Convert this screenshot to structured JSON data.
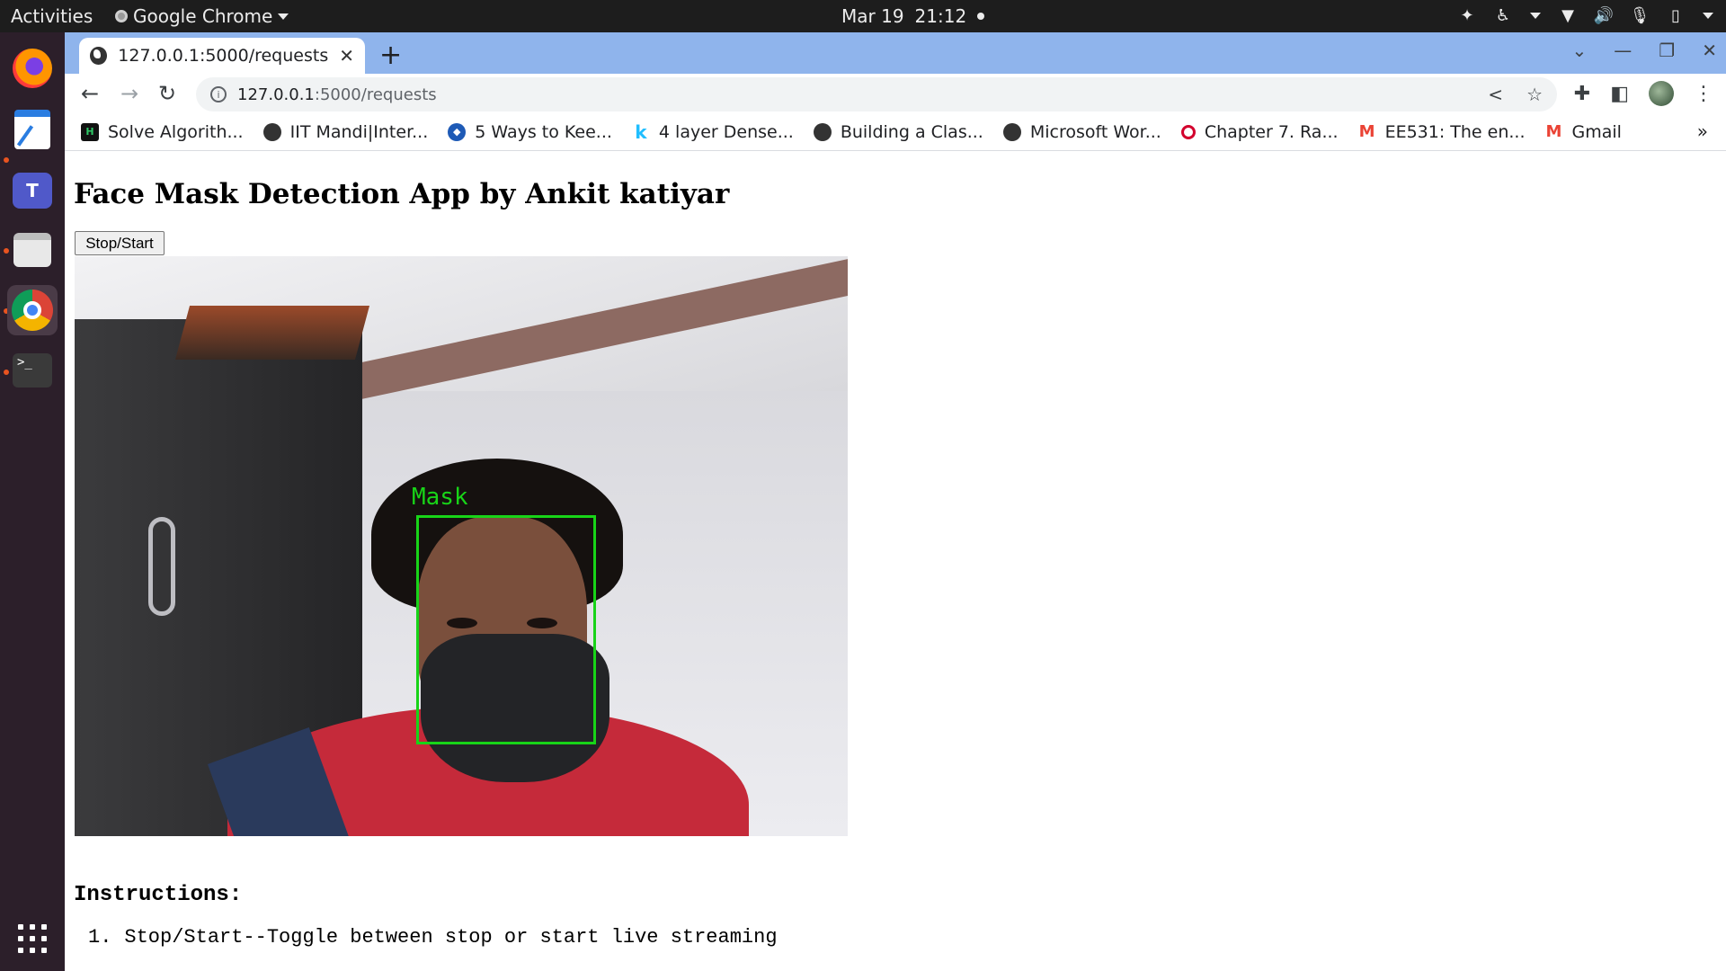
{
  "topbar": {
    "activities": "Activities",
    "app_name": "Google Chrome",
    "date": "Mar 19",
    "time": "21:12"
  },
  "dock": {
    "items": [
      "firefox",
      "text-editor",
      "teams",
      "files",
      "chrome",
      "terminal"
    ],
    "accent": "#e95420"
  },
  "browser": {
    "tab_title": "127.0.0.1:5000/requests",
    "url_host": "127.0.0.1",
    "url_path": ":5000/requests",
    "bookmarks": [
      {
        "label": "Solve Algorith...",
        "icon": "hackerrank-icon"
      },
      {
        "label": "IIT Mandi|Inter...",
        "icon": "globe-icon"
      },
      {
        "label": "5 Ways to Kee...",
        "icon": "shield-icon"
      },
      {
        "label": "4 layer Dense...",
        "icon": "kaggle-icon"
      },
      {
        "label": "Building a Clas...",
        "icon": "globe-icon"
      },
      {
        "label": "Microsoft Wor...",
        "icon": "globe-icon"
      },
      {
        "label": "Chapter 7. Ra...",
        "icon": "oreilly-icon"
      },
      {
        "label": "EE531: The en...",
        "icon": "gmail-icon"
      },
      {
        "label": "Gmail",
        "icon": "gmail-icon"
      }
    ]
  },
  "page": {
    "heading": "Face Mask Detection App by Ankit katiyar",
    "toggle_button": "Stop/Start",
    "detection_label": "Mask",
    "detection_color": "#18d418",
    "instructions_title": "Instructions:",
    "instructions": [
      {
        "number": "1.",
        "text": "Stop/Start--Toggle between stop or start live streaming"
      }
    ]
  }
}
